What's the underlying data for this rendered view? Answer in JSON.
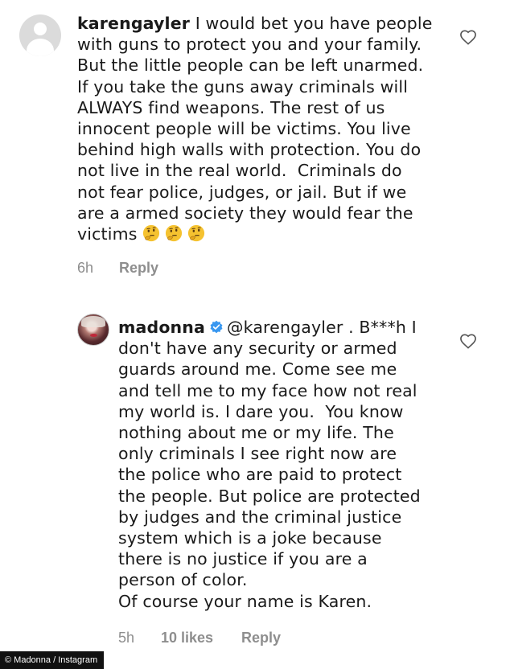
{
  "comments": [
    {
      "username": "karengayler",
      "lines": [
        "I would bet you have people",
        "with guns to protect you and your family.",
        "But the little people can be left unarmed.",
        "If you take the guns away criminals will",
        "ALWAYS find weapons. The rest of us",
        "innocent people will be victims. You live",
        "behind high walls with protection. You do",
        "not live in the real world.  Criminals do",
        "not fear police, judges, or jail. But if we",
        "are a armed society they would fear the",
        "victims"
      ],
      "emojis": [
        "thinking-face",
        "thinking-face",
        "thinking-face"
      ],
      "time": "6h",
      "reply_label": "Reply",
      "avatar": "default-avatar-icon",
      "like_icon": "heart-outline-icon"
    },
    {
      "username": "madonna",
      "verified": true,
      "mention": "@karengayler",
      "first_line_rest": " . B***h I",
      "lines": [
        "don't have any security or armed",
        "guards around me. Come see me",
        "and tell me to my face how not real",
        "my world is. I dare you.  You know",
        "nothing about me or my life. The",
        "only criminals I see right now are",
        "the police who are paid to protect",
        "the people. But police are protected",
        "by judges and the criminal justice",
        "system which is a joke because",
        "there is no justice if you are a",
        "person of color.",
        "Of course your name is Karen."
      ],
      "time": "5h",
      "likes": "10 likes",
      "reply_label": "Reply",
      "avatar": "profile-photo",
      "like_icon": "heart-outline-icon"
    }
  ],
  "caption": "© Madonna / Instagram",
  "colors": {
    "text": "#1a1a1a",
    "meta": "#8e8e8e",
    "verified": "#3897f0",
    "avatar_placeholder": "#dbdbdb"
  }
}
